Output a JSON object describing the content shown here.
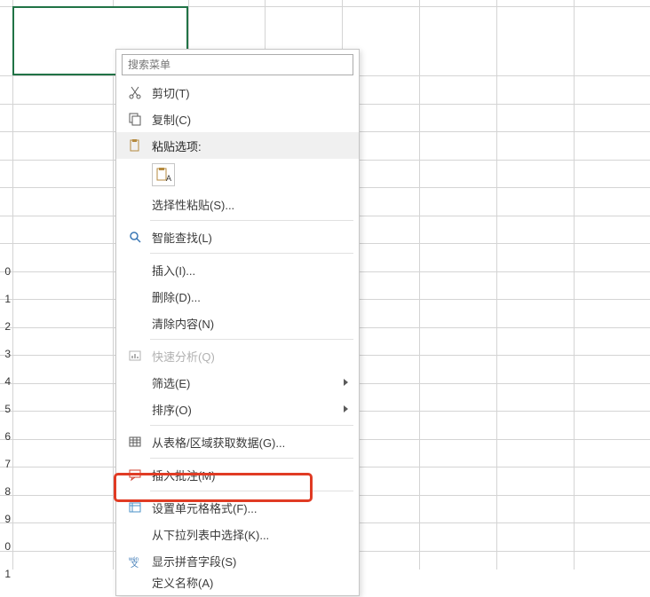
{
  "search": {
    "placeholder": "搜索菜单"
  },
  "menu": {
    "cut": "剪切(T)",
    "copy": "复制(C)",
    "pasteOptionsHeader": "粘贴选项:",
    "pasteSpecial": "选择性粘贴(S)...",
    "smartLookup": "智能查找(L)",
    "insert": "插入(I)...",
    "delete": "删除(D)...",
    "clearContents": "清除内容(N)",
    "quickAnalysis": "快速分析(Q)",
    "filter": "筛选(E)",
    "sort": "排序(O)",
    "getDataFromTable": "从表格/区域获取数据(G)...",
    "insertComment": "插入批注(M)",
    "formatCells": "设置单元格格式(F)...",
    "pickFromDropdown": "从下拉列表中选择(K)...",
    "showPhonetic": "显示拼音字段(S)",
    "defineName": "定义名称(A)"
  },
  "rowNumbers": [
    "0",
    "1",
    "2",
    "3",
    "4",
    "5",
    "6",
    "7",
    "8",
    "9",
    "0",
    "1"
  ]
}
